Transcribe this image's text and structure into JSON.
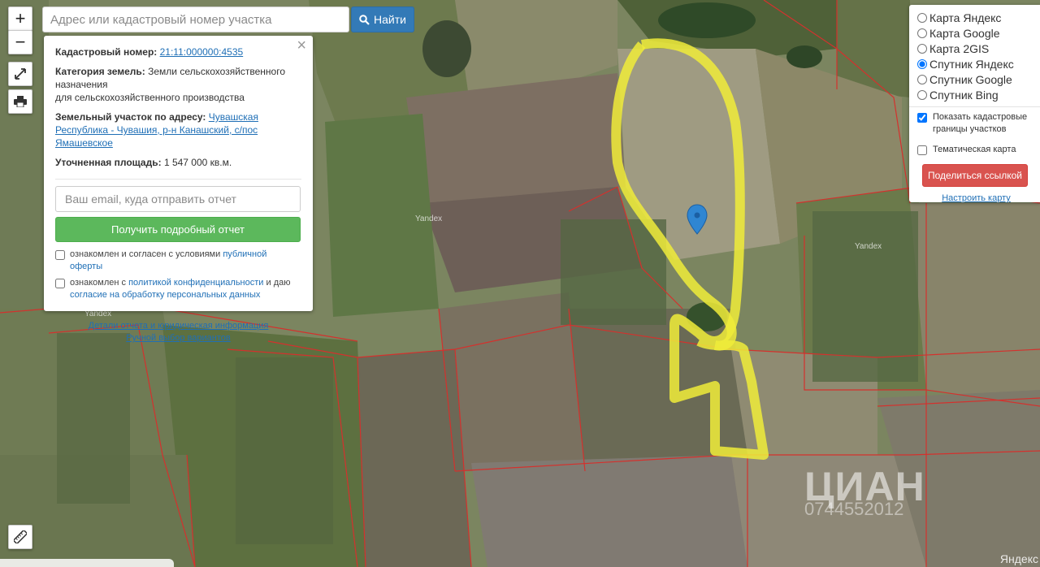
{
  "search": {
    "placeholder": "Адрес или кадастровый номер участка",
    "button_label": "Найти"
  },
  "zoom": {
    "in_label": "+",
    "out_label": "−"
  },
  "info": {
    "cadastral_label": "Кадастровый номер:",
    "cadastral_value": "21:11:000000:4535",
    "category_label": "Категория земель:",
    "category_value": "Земли сельскохозяйственного назначения",
    "category_value2": "для сельскохозяйственного производства",
    "address_label": "Земельный участок по адресу:",
    "address_value": "Чувашская Республика - Чувашия, р-н Канашский, с/пос Ямашевское",
    "area_label": "Уточненная площадь:",
    "area_value": "1 547 000 кв.м.",
    "email_placeholder": "Ваш email, куда отправить отчет",
    "report_button": "Получить подробный отчет",
    "consent1_text": "ознакомлен и согласен с условиями",
    "consent1_link": "публичной оферты",
    "consent2_text": "ознакомлен с",
    "consent2_link": "политикой конфиденциальности",
    "consent2_tail": "и даю",
    "consent2_link2": "согласие на обработку персональных данных",
    "details_link": "Детали отчета и юридическая информация",
    "manual_link": "Ручной выбор вариантов"
  },
  "layers": {
    "options": [
      {
        "label": "Карта Яндекс",
        "selected": false
      },
      {
        "label": "Карта Google",
        "selected": false
      },
      {
        "label": "Карта 2GIS",
        "selected": false
      },
      {
        "label": "Спутник Яндекс",
        "selected": true
      },
      {
        "label": "Спутник Google",
        "selected": false
      },
      {
        "label": "Спутник Bing",
        "selected": false
      }
    ],
    "show_cadastral": "Показать кадастровые границы участков",
    "thematic": "Тематическая карта",
    "share_button": "Поделиться ссылкой",
    "configure_link": "Настроить карту"
  },
  "watermark": {
    "text": "ЦИАН",
    "number": "0744552012"
  },
  "yandex_labels": [
    "Yandex",
    "Yandex",
    "Yandex"
  ],
  "yandex_br": "Яндекс",
  "colors": {
    "search_btn": "#337ab7",
    "report_btn": "#5cb85c",
    "share_btn": "#d9534f",
    "highlight": "#f0ec3a",
    "boundary": "#d4312d",
    "link": "#1f6fb6"
  }
}
